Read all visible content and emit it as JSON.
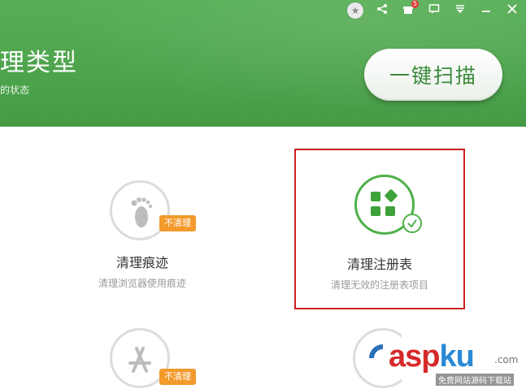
{
  "header": {
    "title": "理类型",
    "subtitle": "的状态",
    "scan_button_label": "一键扫描"
  },
  "title_bar": {
    "icons": [
      "skin-icon",
      "share-icon",
      "gift-icon",
      "feedback-icon",
      "menu-icon",
      "minimize-icon",
      "close-icon"
    ],
    "gift_badge": "5"
  },
  "cards": [
    {
      "title": "清理痕迹",
      "desc": "清理浏览器使用痕迹",
      "badge": "不清理",
      "icon": "footprint-icon",
      "selected": false
    },
    {
      "title": "清理注册表",
      "desc": "清理无效的注册表项目",
      "icon": "registry-icon",
      "selected": true
    },
    {
      "badge": "不清理",
      "icon": "app-store-icon"
    },
    {
      "icon": "partial-icon"
    }
  ],
  "watermark": {
    "asp": "asp",
    "ku": "ku",
    "net": ".com",
    "sub": "免费网站源码下载站"
  },
  "colors": {
    "header_green": "#4ea44d",
    "selection_red": "#cc1f1f",
    "badge_orange": "#f39a2b",
    "accent_green": "#4fb04a"
  }
}
